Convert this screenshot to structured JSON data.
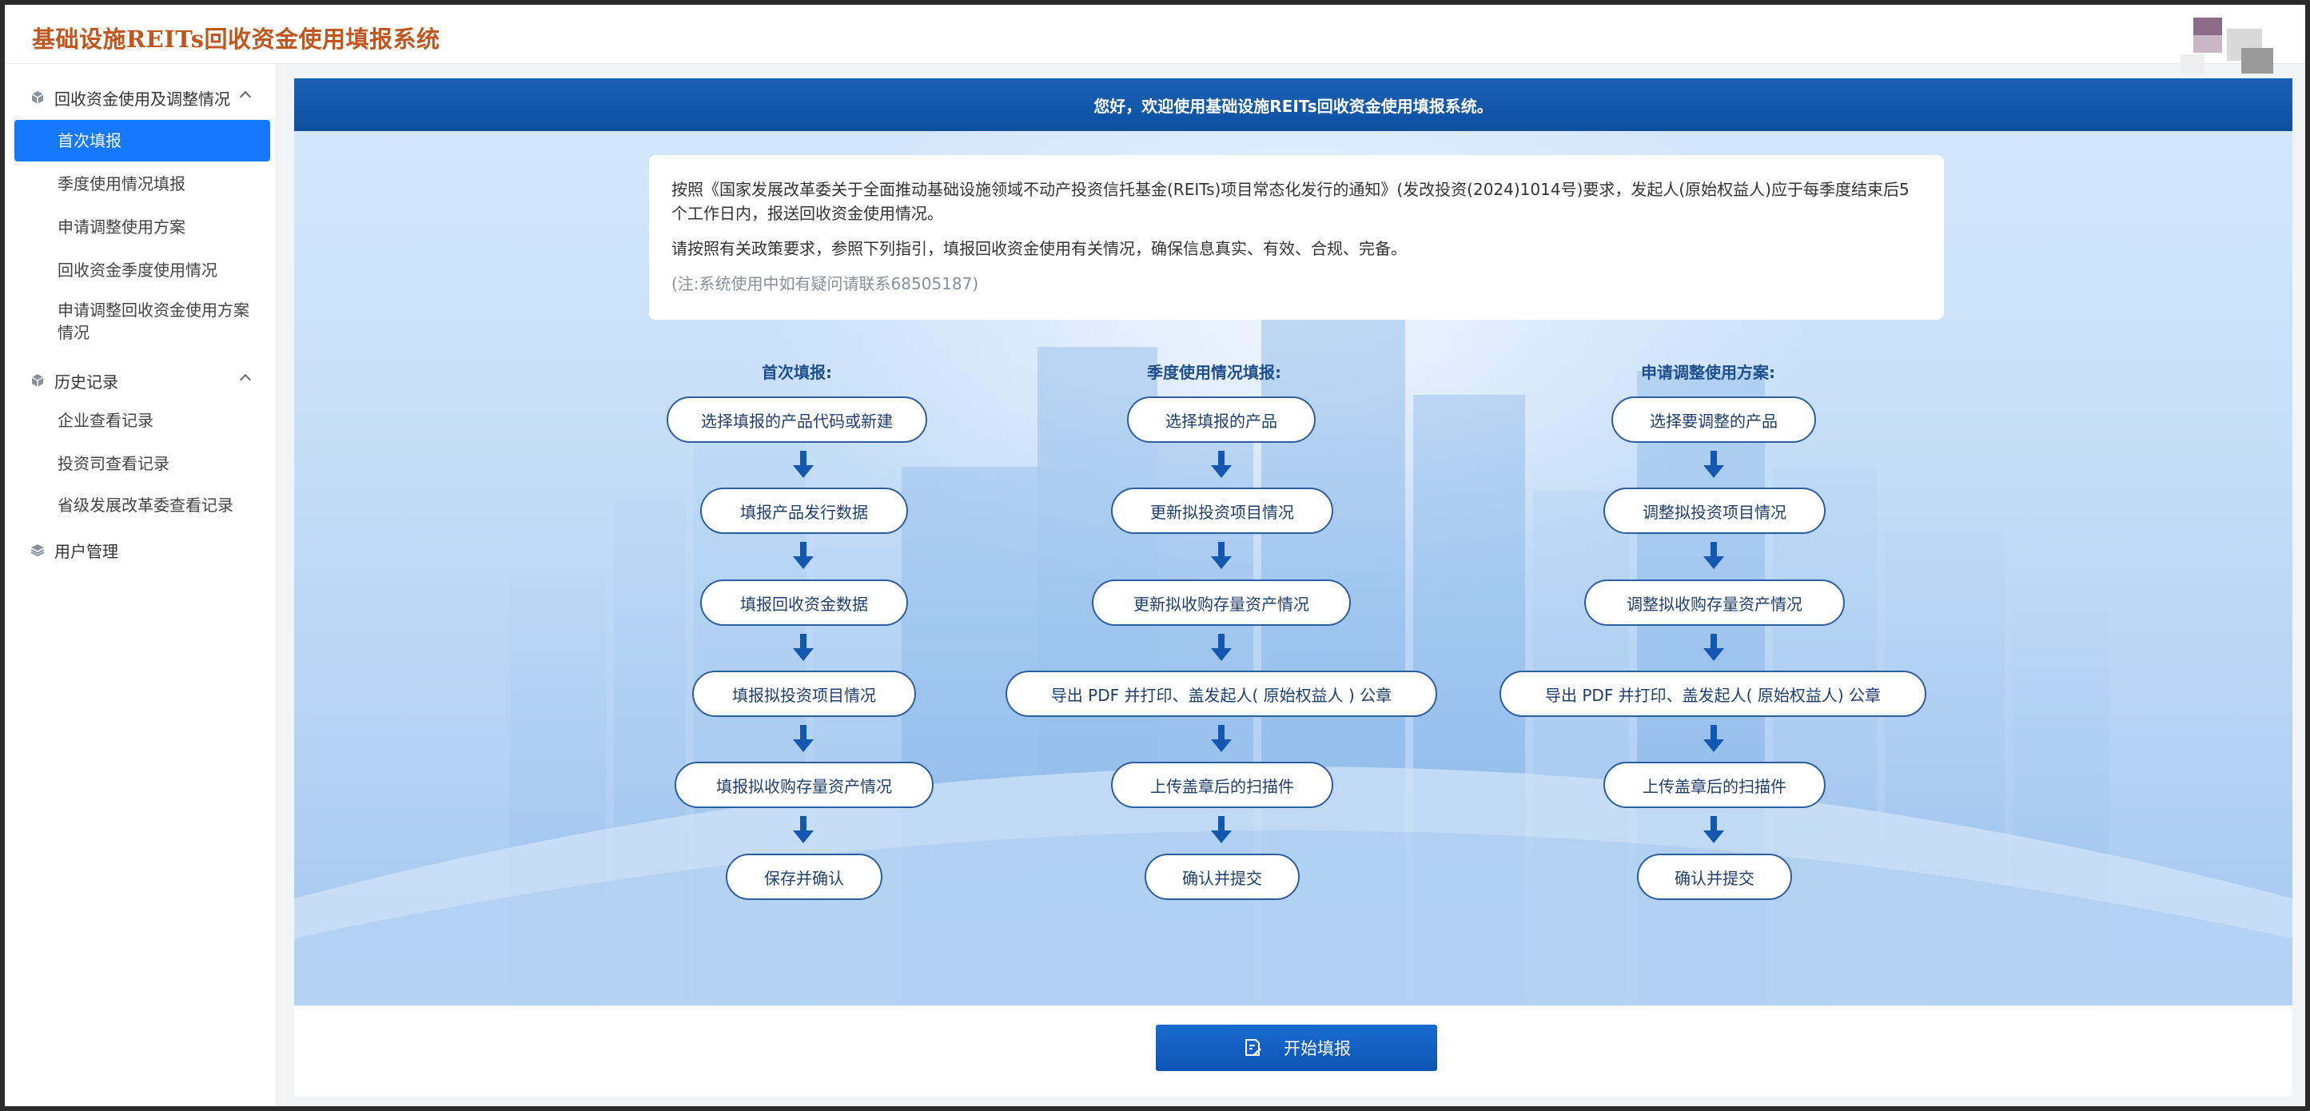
{
  "app": {
    "title": "基础设施REITs回收资金使用填报系统"
  },
  "sidebar": {
    "groups": [
      {
        "label": "回收资金使用及调整情况",
        "icon": "cube-icon",
        "expanded": true,
        "items": [
          {
            "label": "首次填报",
            "active": true
          },
          {
            "label": "季度使用情况填报"
          },
          {
            "label": "申请调整使用方案"
          },
          {
            "label": "回收资金季度使用情况"
          },
          {
            "label": "申请调整回收资金使用方案情况"
          }
        ]
      },
      {
        "label": "历史记录",
        "icon": "cube-icon",
        "expanded": true,
        "items": [
          {
            "label": "企业查看记录"
          },
          {
            "label": "投资司查看记录"
          },
          {
            "label": "省级发展改革委查看记录"
          }
        ]
      },
      {
        "label": "用户管理",
        "icon": "layers-icon",
        "expanded": false,
        "items": []
      }
    ]
  },
  "main": {
    "welcome": "您好，欢迎使用基础设施REITs回收资金使用填报系统。",
    "notice": {
      "p1": "按照《国家发展改革委关于全面推动基础设施领域不动产投资信托基金(REITs)项目常态化发行的通知》(发改投资(2024)1014号)要求，发起人(原始权益人)应于每季度结束后5个工作日内，报送回收资金使用情况。",
      "p2": "请按照有关政策要求，参照下列指引，填报回收资金使用有关情况，确保信息真实、有效、合规、完备。",
      "note": "(注:系统使用中如有疑问请联系68505187)"
    },
    "flows": [
      {
        "title": "首次填报:",
        "steps": [
          "选择填报的产品代码或新建",
          "填报产品发行数据",
          "填报回收资金数据",
          "填报拟投资项目情况",
          "填报拟收购存量资产情况",
          "保存并确认"
        ]
      },
      {
        "title": "季度使用情况填报:",
        "steps": [
          "选择填报的产品",
          "更新拟投资项目情况",
          "更新拟收购存量资产情况",
          "导出 PDF 并打印、盖发起人( 原始权益人 ) 公章",
          "上传盖章后的扫描件",
          "确认并提交"
        ]
      },
      {
        "title": "申请调整使用方案:",
        "steps": [
          "选择要调整的产品",
          "调整拟投资项目情况",
          "调整拟收购存量资产情况",
          "导出 PDF 并打印、盖发起人( 原始权益人) 公章",
          "上传盖章后的扫描件",
          "确认并提交"
        ]
      }
    ],
    "start_button": "开始填报"
  },
  "colors": {
    "accent": "#1677ff",
    "title": "#c0571f",
    "banner": "#0e4f9e",
    "step_border": "#2e5e9e"
  }
}
